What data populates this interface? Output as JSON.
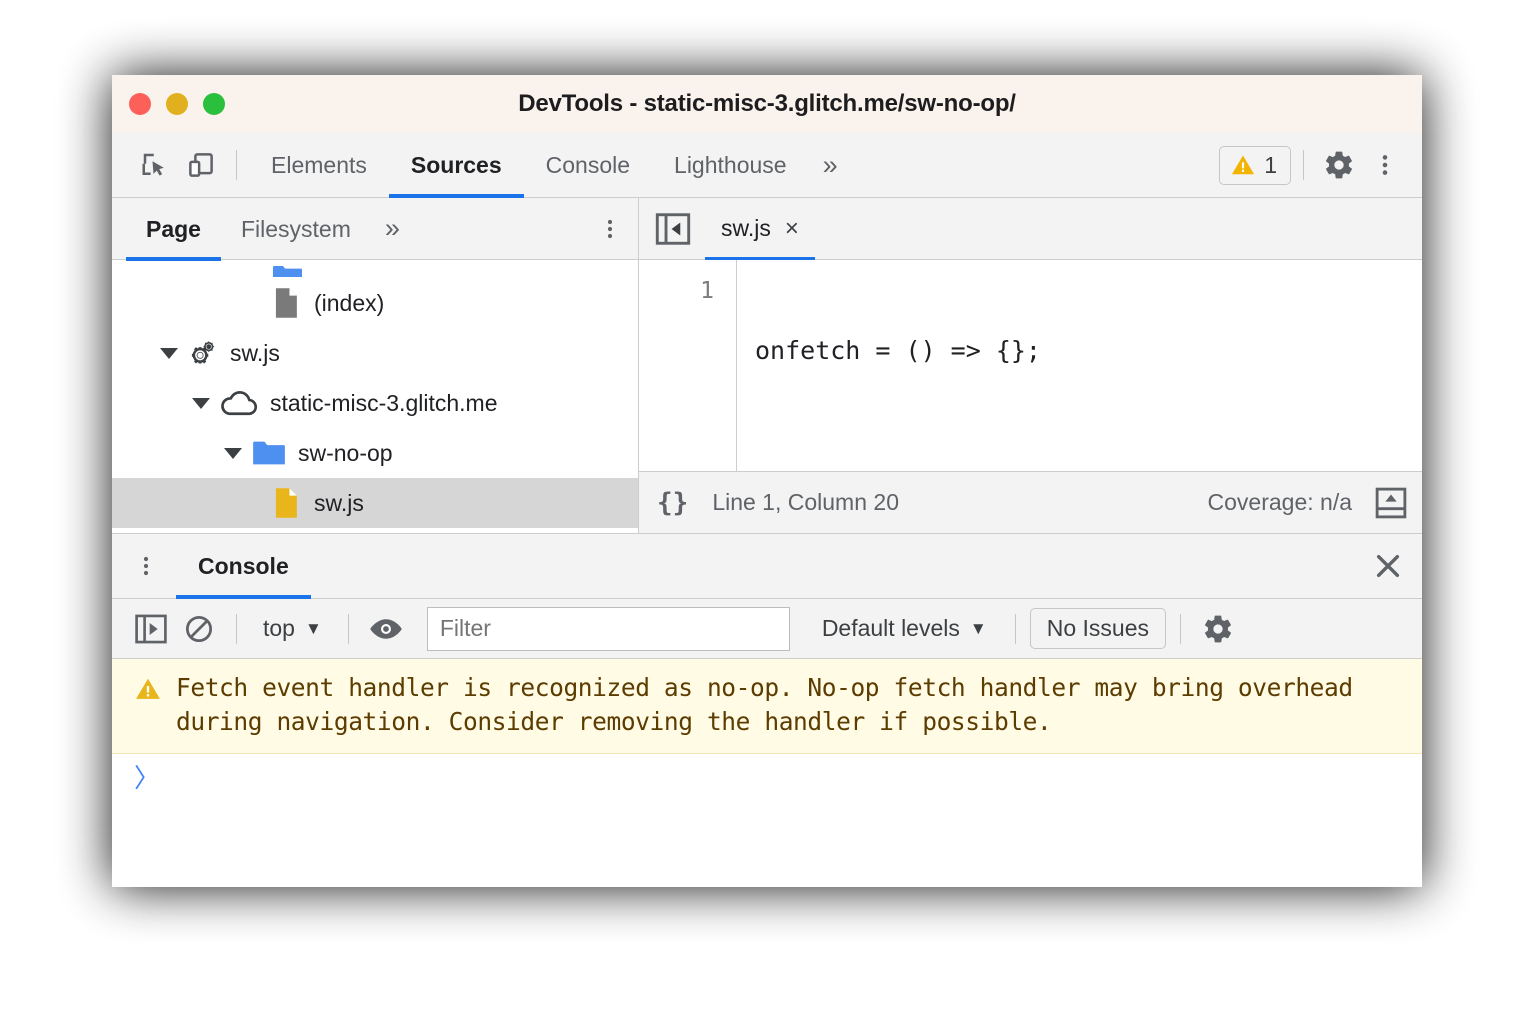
{
  "window": {
    "title": "DevTools - static-misc-3.glitch.me/sw-no-op/",
    "traffic_lights": {
      "close": "close-red",
      "minimize": "minimize-yellow",
      "maximize": "maximize-green",
      "red": "#fc6058",
      "yellow": "#e0b01e",
      "green": "#2abf3d"
    }
  },
  "toolbar": {
    "inspect_icon": "inspect-element-icon",
    "device_icon": "device-toolbar-icon",
    "tabs": [
      {
        "label": "Elements",
        "selected": false
      },
      {
        "label": "Sources",
        "selected": true
      },
      {
        "label": "Console",
        "selected": false
      },
      {
        "label": "Lighthouse",
        "selected": false
      }
    ],
    "more_tabs": "»",
    "warning_count": "1",
    "warning_icon": "warning-triangle-icon",
    "settings_icon": "gear-icon",
    "menu_icon": "dots-vertical-icon",
    "accent": "#1a73e8"
  },
  "navigator": {
    "tabs": [
      {
        "label": "Page",
        "selected": true
      },
      {
        "label": "Filesystem",
        "selected": false
      }
    ],
    "more_tabs": "»",
    "menu_icon": "dots-vertical-icon",
    "tree": [
      {
        "label": "(index)",
        "icon": "file-document-icon",
        "indent": 3,
        "arrow": "none",
        "selected": false
      },
      {
        "label": "sw.js",
        "icon": "service-worker-gears-icon",
        "indent": 1,
        "arrow": "open",
        "selected": false
      },
      {
        "label": "static-misc-3.glitch.me",
        "icon": "cloud-icon",
        "indent": 2,
        "arrow": "open",
        "selected": false
      },
      {
        "label": "sw-no-op",
        "icon": "folder-blue-icon",
        "indent": 3,
        "arrow": "open",
        "selected": false
      },
      {
        "label": "sw.js",
        "icon": "file-script-yellow-icon",
        "indent": 4,
        "arrow": "none",
        "selected": true
      }
    ]
  },
  "editor": {
    "collapse_icon": "collapse-navigator-icon",
    "tab": {
      "label": "sw.js",
      "close": "×"
    },
    "lines": [
      {
        "number": "1",
        "code": "onfetch = () => {};"
      }
    ],
    "status": {
      "pretty_print": "{}",
      "cursor": "Line 1, Column 20",
      "coverage": "Coverage: n/a",
      "drawer_toggle_icon": "show-drawer-icon"
    }
  },
  "drawer": {
    "menu_icon": "dots-vertical-icon",
    "tab": "Console",
    "close_icon": "close-icon",
    "console_toolbar": {
      "sidebar_icon": "console-sidebar-icon",
      "clear_icon": "clear-console-icon",
      "context": "top",
      "context_caret": "▼",
      "eye_icon": "live-expression-eye-icon",
      "filter_placeholder": "Filter",
      "filter_value": "",
      "levels": "Default levels",
      "levels_caret": "▼",
      "issues_button": "No Issues",
      "settings_icon": "gear-icon"
    },
    "messages": [
      {
        "level": "warning",
        "icon": "warning-triangle-icon",
        "text": "Fetch event handler is recognized as no-op. No-op fetch handler may bring overhead during navigation. Consider removing the handler if possible."
      }
    ],
    "prompt": "〉"
  }
}
